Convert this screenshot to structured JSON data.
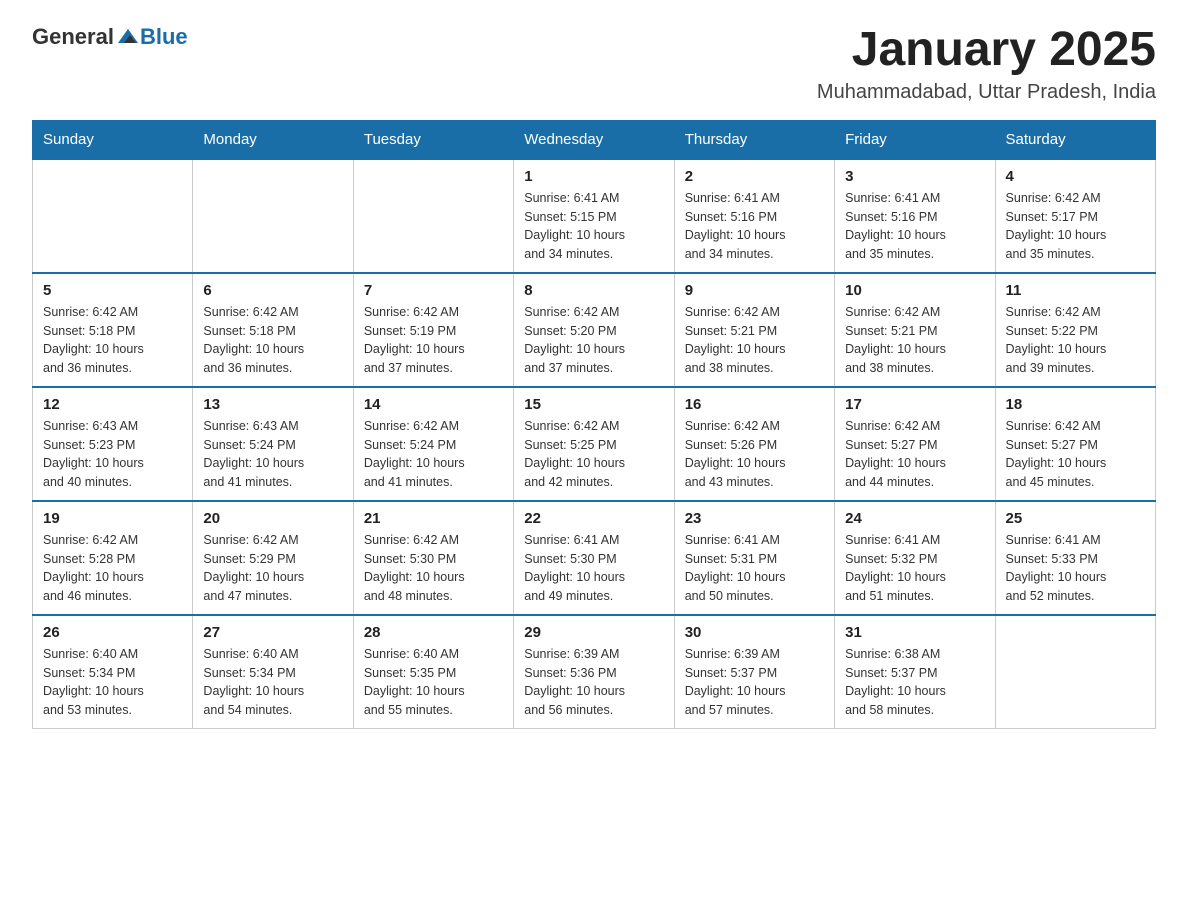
{
  "header": {
    "logo_general": "General",
    "logo_blue": "Blue",
    "month": "January 2025",
    "location": "Muhammadabad, Uttar Pradesh, India"
  },
  "weekdays": [
    "Sunday",
    "Monday",
    "Tuesday",
    "Wednesday",
    "Thursday",
    "Friday",
    "Saturday"
  ],
  "weeks": [
    [
      {
        "day": "",
        "info": ""
      },
      {
        "day": "",
        "info": ""
      },
      {
        "day": "",
        "info": ""
      },
      {
        "day": "1",
        "info": "Sunrise: 6:41 AM\nSunset: 5:15 PM\nDaylight: 10 hours\nand 34 minutes."
      },
      {
        "day": "2",
        "info": "Sunrise: 6:41 AM\nSunset: 5:16 PM\nDaylight: 10 hours\nand 34 minutes."
      },
      {
        "day": "3",
        "info": "Sunrise: 6:41 AM\nSunset: 5:16 PM\nDaylight: 10 hours\nand 35 minutes."
      },
      {
        "day": "4",
        "info": "Sunrise: 6:42 AM\nSunset: 5:17 PM\nDaylight: 10 hours\nand 35 minutes."
      }
    ],
    [
      {
        "day": "5",
        "info": "Sunrise: 6:42 AM\nSunset: 5:18 PM\nDaylight: 10 hours\nand 36 minutes."
      },
      {
        "day": "6",
        "info": "Sunrise: 6:42 AM\nSunset: 5:18 PM\nDaylight: 10 hours\nand 36 minutes."
      },
      {
        "day": "7",
        "info": "Sunrise: 6:42 AM\nSunset: 5:19 PM\nDaylight: 10 hours\nand 37 minutes."
      },
      {
        "day": "8",
        "info": "Sunrise: 6:42 AM\nSunset: 5:20 PM\nDaylight: 10 hours\nand 37 minutes."
      },
      {
        "day": "9",
        "info": "Sunrise: 6:42 AM\nSunset: 5:21 PM\nDaylight: 10 hours\nand 38 minutes."
      },
      {
        "day": "10",
        "info": "Sunrise: 6:42 AM\nSunset: 5:21 PM\nDaylight: 10 hours\nand 38 minutes."
      },
      {
        "day": "11",
        "info": "Sunrise: 6:42 AM\nSunset: 5:22 PM\nDaylight: 10 hours\nand 39 minutes."
      }
    ],
    [
      {
        "day": "12",
        "info": "Sunrise: 6:43 AM\nSunset: 5:23 PM\nDaylight: 10 hours\nand 40 minutes."
      },
      {
        "day": "13",
        "info": "Sunrise: 6:43 AM\nSunset: 5:24 PM\nDaylight: 10 hours\nand 41 minutes."
      },
      {
        "day": "14",
        "info": "Sunrise: 6:42 AM\nSunset: 5:24 PM\nDaylight: 10 hours\nand 41 minutes."
      },
      {
        "day": "15",
        "info": "Sunrise: 6:42 AM\nSunset: 5:25 PM\nDaylight: 10 hours\nand 42 minutes."
      },
      {
        "day": "16",
        "info": "Sunrise: 6:42 AM\nSunset: 5:26 PM\nDaylight: 10 hours\nand 43 minutes."
      },
      {
        "day": "17",
        "info": "Sunrise: 6:42 AM\nSunset: 5:27 PM\nDaylight: 10 hours\nand 44 minutes."
      },
      {
        "day": "18",
        "info": "Sunrise: 6:42 AM\nSunset: 5:27 PM\nDaylight: 10 hours\nand 45 minutes."
      }
    ],
    [
      {
        "day": "19",
        "info": "Sunrise: 6:42 AM\nSunset: 5:28 PM\nDaylight: 10 hours\nand 46 minutes."
      },
      {
        "day": "20",
        "info": "Sunrise: 6:42 AM\nSunset: 5:29 PM\nDaylight: 10 hours\nand 47 minutes."
      },
      {
        "day": "21",
        "info": "Sunrise: 6:42 AM\nSunset: 5:30 PM\nDaylight: 10 hours\nand 48 minutes."
      },
      {
        "day": "22",
        "info": "Sunrise: 6:41 AM\nSunset: 5:30 PM\nDaylight: 10 hours\nand 49 minutes."
      },
      {
        "day": "23",
        "info": "Sunrise: 6:41 AM\nSunset: 5:31 PM\nDaylight: 10 hours\nand 50 minutes."
      },
      {
        "day": "24",
        "info": "Sunrise: 6:41 AM\nSunset: 5:32 PM\nDaylight: 10 hours\nand 51 minutes."
      },
      {
        "day": "25",
        "info": "Sunrise: 6:41 AM\nSunset: 5:33 PM\nDaylight: 10 hours\nand 52 minutes."
      }
    ],
    [
      {
        "day": "26",
        "info": "Sunrise: 6:40 AM\nSunset: 5:34 PM\nDaylight: 10 hours\nand 53 minutes."
      },
      {
        "day": "27",
        "info": "Sunrise: 6:40 AM\nSunset: 5:34 PM\nDaylight: 10 hours\nand 54 minutes."
      },
      {
        "day": "28",
        "info": "Sunrise: 6:40 AM\nSunset: 5:35 PM\nDaylight: 10 hours\nand 55 minutes."
      },
      {
        "day": "29",
        "info": "Sunrise: 6:39 AM\nSunset: 5:36 PM\nDaylight: 10 hours\nand 56 minutes."
      },
      {
        "day": "30",
        "info": "Sunrise: 6:39 AM\nSunset: 5:37 PM\nDaylight: 10 hours\nand 57 minutes."
      },
      {
        "day": "31",
        "info": "Sunrise: 6:38 AM\nSunset: 5:37 PM\nDaylight: 10 hours\nand 58 minutes."
      },
      {
        "day": "",
        "info": ""
      }
    ]
  ]
}
